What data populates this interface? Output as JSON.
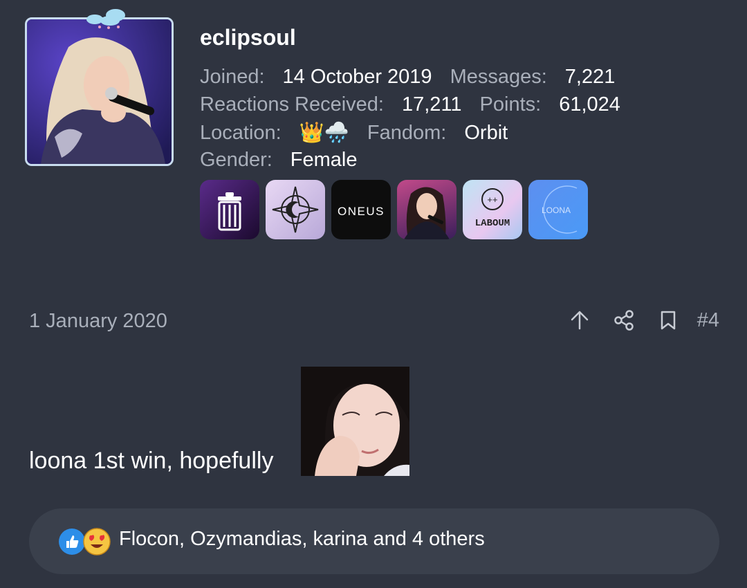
{
  "user": {
    "username": "eclipsoul",
    "joined_label": "Joined:",
    "joined_value": "14 October 2019",
    "messages_label": "Messages:",
    "messages_value": "7,221",
    "reactions_label": "Reactions Received:",
    "reactions_value": "17,211",
    "points_label": "Points:",
    "points_value": "61,024",
    "location_label": "Location:",
    "location_value": "👑🌧️",
    "fandom_label": "Fandom:",
    "fandom_value": "Orbit",
    "gender_label": "Gender:",
    "gender_value": "Female",
    "badges": [
      {
        "name": "trash-can-badge"
      },
      {
        "name": "compass-crescent-badge"
      },
      {
        "name": "oneus-badge",
        "text": "ONEUS"
      },
      {
        "name": "singer-photo-badge"
      },
      {
        "name": "laboum-badge",
        "text": "LABOUM"
      },
      {
        "name": "loona-badge",
        "text": "LOONA"
      }
    ]
  },
  "post": {
    "date": "1 January 2020",
    "number": "#4",
    "text": "loona 1st win, hopefully",
    "icons": [
      "arrow-up-icon",
      "share-icon",
      "bookmark-icon"
    ]
  },
  "reactions": {
    "summary": "Flocon, Ozymandias, karina and 4 others",
    "icons": [
      "like-icon",
      "love-icon"
    ]
  },
  "colors": {
    "background": "#2f3440",
    "reaction_bar": "#3a404c",
    "label": "#a9afba",
    "avatar_border": "#c8dcef"
  }
}
